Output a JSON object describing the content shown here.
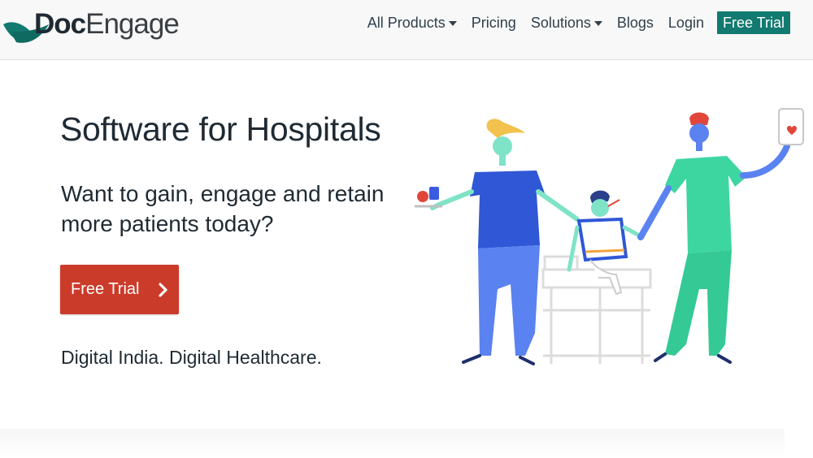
{
  "brand": {
    "name_part1": "Doc",
    "name_part2": "Engage",
    "color": "#127a70"
  },
  "nav": {
    "items": [
      {
        "label": "All Products",
        "has_dropdown": true
      },
      {
        "label": "Pricing",
        "has_dropdown": false
      },
      {
        "label": "Solutions",
        "has_dropdown": true
      },
      {
        "label": "Blogs",
        "has_dropdown": false
      },
      {
        "label": "Login",
        "has_dropdown": false
      }
    ],
    "cta_label": "Free Trial"
  },
  "hero": {
    "title": "Software for Hospitals",
    "subtitle": "Want to gain, engage and retain more patients today?",
    "button_label": "Free Trial",
    "button_icon": "chevron-right-icon",
    "tagline": "Digital India. Digital Healthcare."
  },
  "colors": {
    "accent_teal": "#127a70",
    "cta_red": "#cb3b2a",
    "nurse_blue": "#3a5be0",
    "doctor_green": "#3ed6a0"
  }
}
